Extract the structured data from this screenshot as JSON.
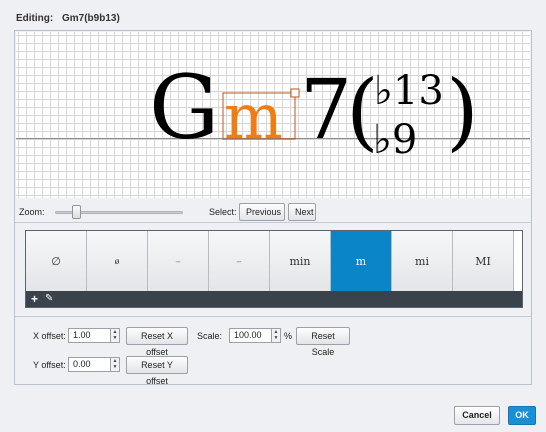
{
  "dialog": {
    "editing_label": "Editing:",
    "chord_name": "Gm7(b9b13)"
  },
  "chord_preview": {
    "root": "G",
    "quality": "m",
    "extension": "7",
    "upper_alteration": "♭13",
    "lower_alteration": "♭9",
    "highlight_color": "#f07d14"
  },
  "toolbar": {
    "zoom_label": "Zoom:",
    "zoom_level": 0.13,
    "select_label": "Select:",
    "previous_label": "Previous",
    "next_label": "Next"
  },
  "palette": {
    "items": [
      {
        "label": "∅"
      },
      {
        "label": "ø"
      },
      {
        "label": "–"
      },
      {
        "label": "–"
      },
      {
        "label": "min"
      },
      {
        "label": "m"
      },
      {
        "label": "mi"
      },
      {
        "label": "MI"
      }
    ],
    "selected_index": 5,
    "add_icon": "plus-icon",
    "edit_icon": "pencil-icon",
    "selected_color": "#0a86c8"
  },
  "offsets": {
    "x_label": "X offset:",
    "x_value": "1.00",
    "reset_x_label": "Reset X offset",
    "y_label": "Y offset:",
    "y_value": "0.00",
    "reset_y_label": "Reset Y offset",
    "scale_label": "Scale:",
    "scale_value": "100.00",
    "scale_unit": "%",
    "reset_scale_label": "Reset Scale"
  },
  "footer": {
    "cancel_label": "Cancel",
    "ok_label": "OK"
  }
}
